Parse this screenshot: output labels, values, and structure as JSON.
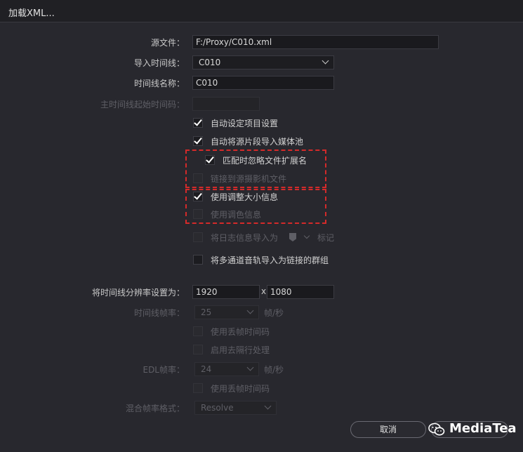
{
  "window": {
    "title": "加载XML..."
  },
  "form": {
    "source_file": {
      "label": "源文件：",
      "value": "F:/Proxy/C010.xml"
    },
    "import_timeline": {
      "label": "导入时间线：",
      "value": "C010"
    },
    "timeline_name": {
      "label": "时间线名称：",
      "value": "C010"
    },
    "master_timecode": {
      "label": "主时间线起始时间码：",
      "value": ""
    },
    "checkboxes": {
      "auto_project": {
        "label": "自动设定项目设置",
        "checked": true
      },
      "auto_import_pool": {
        "label": "自动将源片段导入媒体池",
        "checked": true
      },
      "ignore_ext": {
        "label": "匹配时忽略文件扩展名",
        "checked": true
      },
      "link_camera": {
        "label": "链接到源摄影机文件",
        "checked": false
      },
      "use_resize": {
        "label": "使用调整大小信息",
        "checked": true
      },
      "use_color": {
        "label": "使用调色信息",
        "checked": false
      },
      "log_import": {
        "label": "将日志信息导入为",
        "checked": false
      },
      "multichannel": {
        "label": "将多通道音轨导入为链接的群组",
        "checked": false
      }
    },
    "log_marker_suffix": "标记",
    "resolution": {
      "label": "将时间线分辨率设置为：",
      "width": "1920",
      "sep": "x",
      "height": "1080"
    },
    "timeline_fps": {
      "label": "时间线帧率：",
      "value": "25",
      "unit": "帧/秒"
    },
    "drop_frame_1": {
      "label": "使用丢帧时间码",
      "checked": false
    },
    "deinterlace": {
      "label": "启用去隔行处理",
      "checked": false
    },
    "edl_fps": {
      "label": "EDL帧率：",
      "value": "24",
      "unit": "帧/秒"
    },
    "drop_frame_2": {
      "label": "使用丢帧时间码",
      "checked": false
    },
    "mixed_fps": {
      "label": "混合帧率格式：",
      "value": "Resolve"
    }
  },
  "buttons": {
    "cancel": "取消"
  },
  "watermark": {
    "text": "MediaTea",
    "icon": "wechat-icon"
  },
  "colors": {
    "highlight_box": "#d42a2a",
    "background": "#28282e"
  }
}
